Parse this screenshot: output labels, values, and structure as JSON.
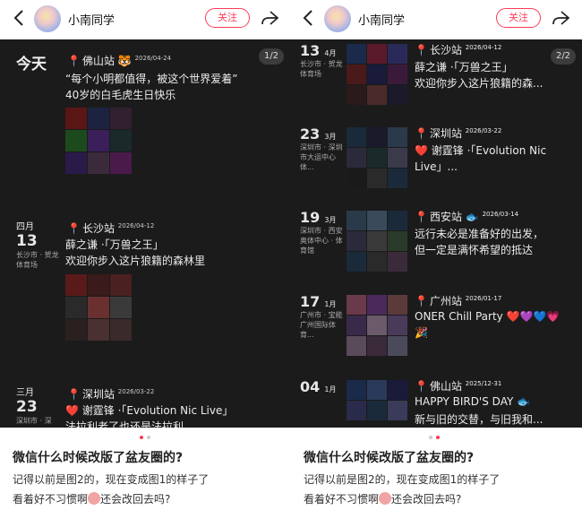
{
  "left": {
    "user": {
      "name": "小南同学",
      "follow": "关注"
    },
    "counter": "1/2",
    "entries": [
      {
        "date": "今天",
        "title": "佛山站",
        "title_emoji": "🐯",
        "date_sup": "2026/04-24",
        "lines": [
          "“每个小明都值得，被这个世界爱着”",
          "40岁的白毛虎生日快乐"
        ]
      },
      {
        "month": "四月",
        "day": "13",
        "place": "长沙市 · 贺龙体育场",
        "title": "长沙站",
        "date_sup": "2026/04-12",
        "lines": [
          "薛之谦 ·「万兽之王」",
          "欢迎你步入这片狼籍的森林里"
        ]
      },
      {
        "month": "三月",
        "day": "23",
        "place": "深圳市 · 深",
        "title": "深圳站",
        "date_sup": "2026/03-22",
        "lines": [
          "❤️ 谢霆锋 ·「Evolution Nic Live」",
          "法拉利老了也还是法拉利"
        ]
      }
    ],
    "question": "微信什么时候改版了盆友圈的?",
    "body1": "记得以前是图2的，现在变成图1的样子了",
    "body2a": "看着好不习惯啊",
    "body2b": "还会改回去吗?"
  },
  "right": {
    "user": {
      "name": "小南同学",
      "follow": "关注"
    },
    "counter": "2/2",
    "entries": [
      {
        "day": "13",
        "mon": "4月",
        "place": "长沙市 · 贺龙体育场",
        "title": "长沙站",
        "date_sup": "2026/04-12",
        "lines": [
          "薛之谦 ·「万兽之王」",
          "欢迎你步入这片狼籍的森..."
        ]
      },
      {
        "day": "23",
        "mon": "3月",
        "place": "深圳市 · 深圳市大运中心体...",
        "title": "深圳站",
        "date_sup": "2026/03-22",
        "lines": [
          "❤️ 谢霆锋 ·「Evolution Nic",
          "Live」..."
        ]
      },
      {
        "day": "19",
        "mon": "3月",
        "place": "深圳市 · 西安奥体中心 · 体育馆",
        "title": "西安站",
        "title_emoji": "🐟",
        "date_sup": "2026/03-14",
        "lines": [
          "远行未必是准备好的出发，",
          "但一定是满怀希望的抵达"
        ]
      },
      {
        "day": "17",
        "mon": "1月",
        "place": "广州市 · 宝能广州国际体育...",
        "title": "广州站",
        "date_sup": "2026/01-17",
        "lines": [
          "ONER Chill Party ❤️💜💙💗",
          "🎉"
        ]
      },
      {
        "day": "04",
        "mon": "1月",
        "place": "",
        "title": "佛山站",
        "date_sup": "2025/12-31",
        "lines": [
          "HAPPY BIRD'S DAY 🐟",
          "新与旧的交替，与旧我和..."
        ]
      }
    ],
    "question": "微信什么时候改版了盆友圈的?",
    "body1": "记得以前是图2的，现在变成图1的样子了",
    "body2a": "看着好不习惯啊",
    "body2b": "还会改回去吗?"
  }
}
